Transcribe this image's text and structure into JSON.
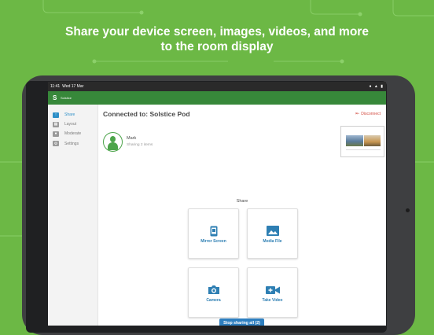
{
  "headline": {
    "line1": "Share your device screen, images, videos, and more",
    "line2": "to the room display"
  },
  "statusbar": {
    "time": "11:41",
    "date": "Wed 17 Mar"
  },
  "appbar": {
    "logo_text": "Solstice"
  },
  "sidebar": {
    "items": [
      {
        "label": "Share",
        "icon": "share-icon",
        "active": true
      },
      {
        "label": "Layout",
        "icon": "layout-icon",
        "active": false
      },
      {
        "label": "Moderate",
        "icon": "moderate-icon",
        "active": false
      },
      {
        "label": "Settings",
        "icon": "gear-icon",
        "active": false
      }
    ]
  },
  "main": {
    "connected_label": "Connected to: Solstice Pod",
    "disconnect_label": "Disconnect",
    "user": {
      "name": "Mark",
      "status": "Sharing 2 items"
    },
    "share_heading": "Share",
    "tiles": [
      {
        "label": "Mirror Screen",
        "icon": "mirror-screen-icon"
      },
      {
        "label": "Media File",
        "icon": "image-icon"
      },
      {
        "label": "Camera",
        "icon": "camera-icon"
      },
      {
        "label": "Take Video",
        "icon": "video-camera-icon"
      }
    ],
    "stop_button": "Stop sharing all (2)"
  },
  "colors": {
    "background": "#6cb845",
    "appbar": "#37883a",
    "accent": "#2e7fc0",
    "disconnect": "#d24a3f"
  }
}
